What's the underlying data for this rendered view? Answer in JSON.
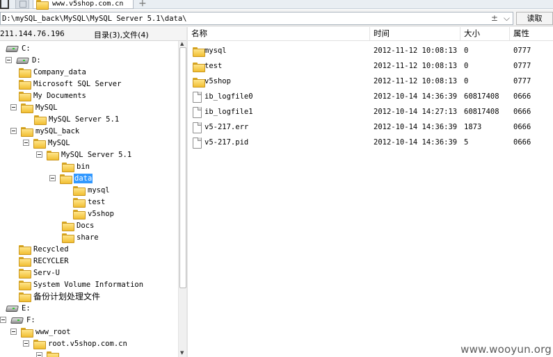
{
  "tab": {
    "title": "www.v5shop.com.cn",
    "new_tab_glyph": "+"
  },
  "pathbar": {
    "path": "D:\\mySQL_back\\MySQL\\MySQL Server 5.1\\data\\",
    "read_button": "读取",
    "icons": [
      "add-icon",
      "chevron-down-icon"
    ]
  },
  "left_panel": {
    "ip": "211.144.76.196",
    "counts": "目录(3),文件(4)"
  },
  "tree": [
    {
      "label": "C:",
      "type": "drive",
      "toggle": "none"
    },
    {
      "label": "D:",
      "type": "drive",
      "toggle": "minus"
    },
    {
      "label": "Company_data",
      "type": "folder",
      "toggle": "none"
    },
    {
      "label": "Microsoft SQL Server",
      "type": "folder",
      "toggle": "none"
    },
    {
      "label": "My Documents",
      "type": "folder",
      "toggle": "none"
    },
    {
      "label": "MySQL",
      "type": "folder",
      "toggle": "minus"
    },
    {
      "label": "MySQL Server 5.1",
      "type": "folder",
      "toggle": "none"
    },
    {
      "label": "mySQL_back",
      "type": "folder",
      "toggle": "minus"
    },
    {
      "label": "MySQL",
      "type": "folder",
      "toggle": "minus"
    },
    {
      "label": "MySQL Server 5.1",
      "type": "folder",
      "toggle": "minus"
    },
    {
      "label": "bin",
      "type": "folder",
      "toggle": "none"
    },
    {
      "label": "data",
      "type": "folder",
      "toggle": "minus",
      "selected": true
    },
    {
      "label": "mysql",
      "type": "folder",
      "toggle": "none"
    },
    {
      "label": "test",
      "type": "folder",
      "toggle": "none"
    },
    {
      "label": "v5shop",
      "type": "folder",
      "toggle": "none"
    },
    {
      "label": "Docs",
      "type": "folder",
      "toggle": "none"
    },
    {
      "label": "share",
      "type": "folder",
      "toggle": "none"
    },
    {
      "label": "Recycled",
      "type": "folder",
      "toggle": "none"
    },
    {
      "label": "RECYCLER",
      "type": "folder",
      "toggle": "none"
    },
    {
      "label": "Serv-U",
      "type": "folder",
      "toggle": "none"
    },
    {
      "label": "System Volume Information",
      "type": "folder",
      "toggle": "none"
    },
    {
      "label": "备份计划处理文件",
      "type": "folder",
      "toggle": "none"
    },
    {
      "label": "E:",
      "type": "drive",
      "toggle": "none"
    },
    {
      "label": "F:",
      "type": "drive",
      "toggle": "minus"
    },
    {
      "label": "www_root",
      "type": "folder",
      "toggle": "minus"
    },
    {
      "label": "root.v5shop.com.cn",
      "type": "folder",
      "toggle": "minus"
    },
    {
      "label": "",
      "type": "folder",
      "toggle": "minus"
    }
  ],
  "list": {
    "columns": {
      "name": "名称",
      "time": "时间",
      "size": "大小",
      "attr": "属性"
    },
    "rows": [
      {
        "name": "mysql",
        "time": "2012-11-12 10:08:13",
        "size": "0",
        "attr": "0777",
        "kind": "folder"
      },
      {
        "name": "test",
        "time": "2012-11-12 10:08:13",
        "size": "0",
        "attr": "0777",
        "kind": "folder"
      },
      {
        "name": "v5shop",
        "time": "2012-11-12 10:08:13",
        "size": "0",
        "attr": "0777",
        "kind": "folder"
      },
      {
        "name": "ib_logfile0",
        "time": "2012-10-14 14:36:39",
        "size": "60817408",
        "attr": "0666",
        "kind": "file"
      },
      {
        "name": "ib_logfile1",
        "time": "2012-10-14 14:27:13",
        "size": "60817408",
        "attr": "0666",
        "kind": "file"
      },
      {
        "name": "v5-217.err",
        "time": "2012-10-14 14:36:39",
        "size": "1873",
        "attr": "0666",
        "kind": "file"
      },
      {
        "name": "v5-217.pid",
        "time": "2012-10-14 14:36:39",
        "size": "5",
        "attr": "0666",
        "kind": "file"
      }
    ]
  },
  "watermark": "www.wooyun.org",
  "colors": {
    "selection": "#3399ff",
    "folder": "#f1be32"
  }
}
